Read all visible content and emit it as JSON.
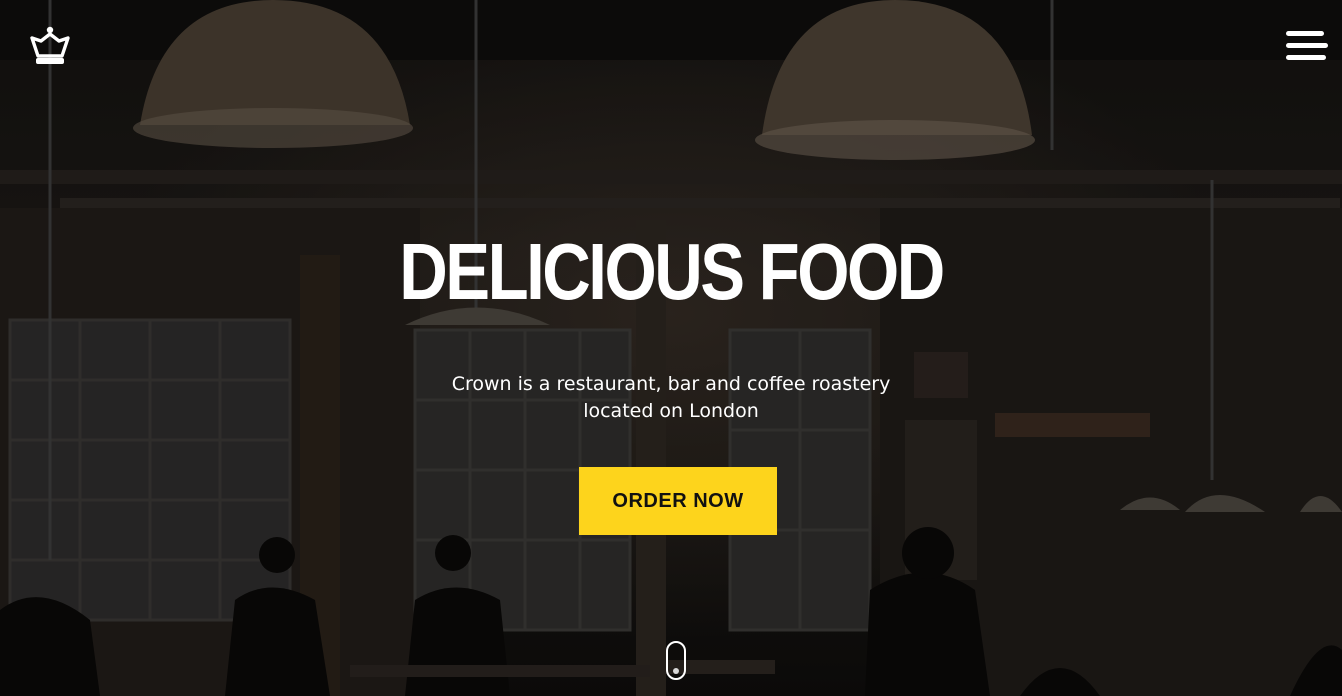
{
  "header": {
    "logo_icon": "crown-icon",
    "menu_icon": "hamburger-menu-icon"
  },
  "hero": {
    "title": "DELICIOUS FOOD",
    "subtitle_line1": "Crown is a restaurant, bar and coffee roastery",
    "subtitle_line2": "located on London",
    "cta_label": "ORDER NOW",
    "scroll_icon": "mouse-scroll-icon"
  },
  "colors": {
    "accent": "#fdd41c",
    "text": "#ffffff",
    "background": "#141210"
  }
}
